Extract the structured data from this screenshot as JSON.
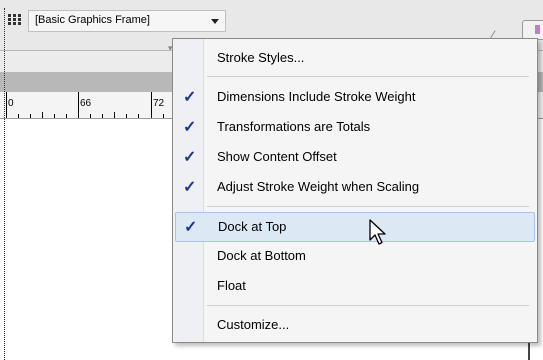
{
  "toolbar": {
    "frame_style": "[Basic Graphics Frame]"
  },
  "ruler": {
    "labels": [
      "0",
      "66",
      "72"
    ]
  },
  "menu": {
    "items": [
      {
        "label": "Stroke Styles...",
        "checked": false
      },
      {
        "label": "Dimensions Include Stroke Weight",
        "checked": true
      },
      {
        "label": "Transformations are Totals",
        "checked": true
      },
      {
        "label": "Show Content Offset",
        "checked": true
      },
      {
        "label": "Adjust Stroke Weight when Scaling",
        "checked": true
      },
      {
        "label": "Dock at Top",
        "checked": true,
        "highlighted": true
      },
      {
        "label": "Dock at Bottom",
        "checked": false
      },
      {
        "label": "Float",
        "checked": false
      },
      {
        "label": "Customize...",
        "checked": false
      }
    ],
    "check_glyph": "✓"
  },
  "colors": {
    "menu_highlight": "#dde8f5",
    "check": "#1c3a8a"
  }
}
